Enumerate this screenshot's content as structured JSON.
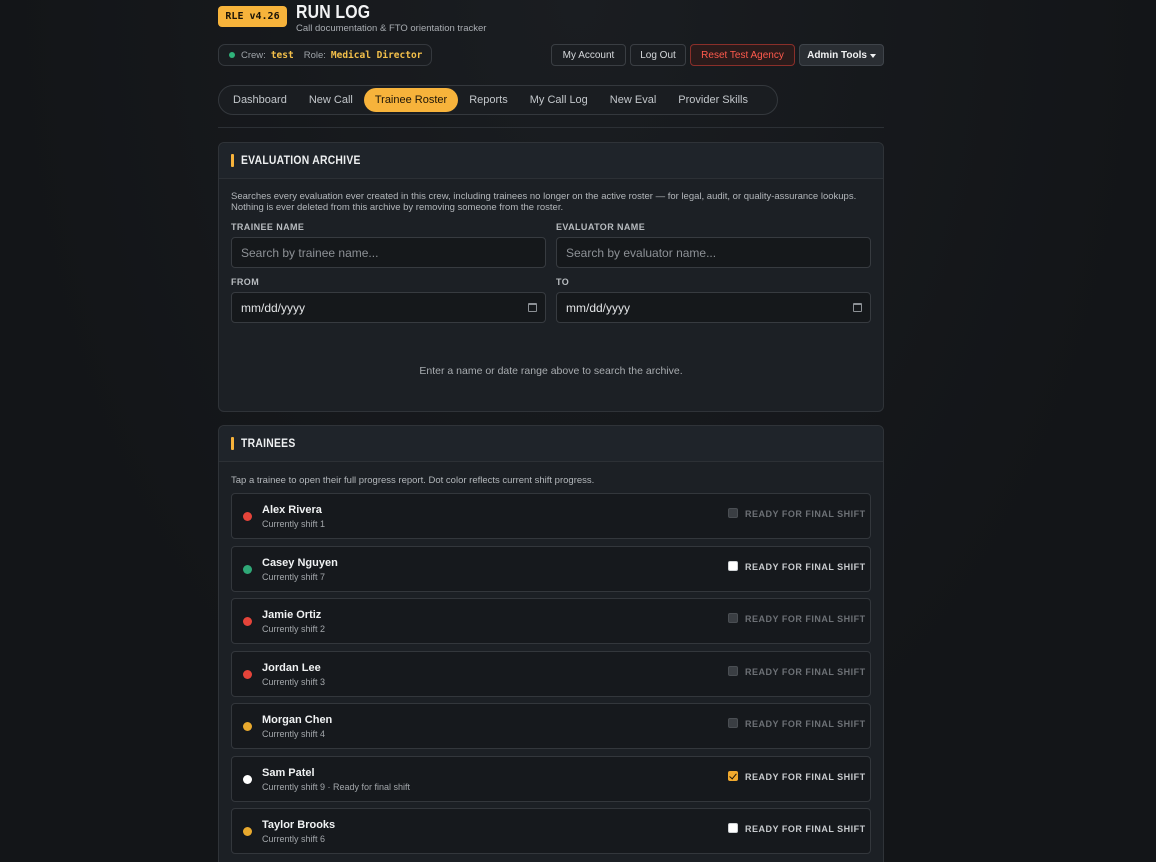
{
  "app": {
    "version": "RLE v4.26",
    "title": "RUN LOG",
    "subtitle": "Call documentation & FTO orientation tracker"
  },
  "session": {
    "crew_label": "Crew:",
    "crew_value": "test",
    "role_label": "Role:",
    "role_value": "Medical Director"
  },
  "toolbar": {
    "my_account": "My Account",
    "log_out": "Log Out",
    "reset": "Reset Test Agency",
    "admin": "Admin Tools"
  },
  "tabs": [
    {
      "label": "Dashboard",
      "active": false
    },
    {
      "label": "New Call",
      "active": false
    },
    {
      "label": "Trainee Roster",
      "active": true
    },
    {
      "label": "Reports",
      "active": false
    },
    {
      "label": "My Call Log",
      "active": false
    },
    {
      "label": "New Eval",
      "active": false
    },
    {
      "label": "Provider Skills",
      "active": false
    }
  ],
  "archive": {
    "title": "EVALUATION ARCHIVE",
    "description": "Searches every evaluation ever created in this crew, including trainees no longer on the active roster — for legal, audit, or quality-assurance lookups. Nothing is ever deleted from this archive by removing someone from the roster.",
    "trainee_label": "TRAINEE NAME",
    "trainee_placeholder": "Search by trainee name...",
    "evaluator_label": "EVALUATOR NAME",
    "evaluator_placeholder": "Search by evaluator name...",
    "from_label": "FROM",
    "from_value": "mm/dd/yyyy",
    "to_label": "TO",
    "to_value": "mm/dd/yyyy",
    "empty_message": "Enter a name or date range above to search the archive."
  },
  "trainees": {
    "title": "TRAINEES",
    "description": "Tap a trainee to open their full progress report. Dot color reflects current shift progress.",
    "ready_label": "READY FOR FINAL SHIFT",
    "list": [
      {
        "name": "Alex Rivera",
        "shift": "Currently shift 1",
        "dot_color": "#e5443a",
        "checkbox": "disabled"
      },
      {
        "name": "Casey Nguyen",
        "shift": "Currently shift 7",
        "dot_color": "#2fa877",
        "checkbox": "enabled"
      },
      {
        "name": "Jamie Ortiz",
        "shift": "Currently shift 2",
        "dot_color": "#e5443a",
        "checkbox": "disabled"
      },
      {
        "name": "Jordan Lee",
        "shift": "Currently shift 3",
        "dot_color": "#e5443a",
        "checkbox": "disabled"
      },
      {
        "name": "Morgan Chen",
        "shift": "Currently shift 4",
        "dot_color": "#e8a92e",
        "checkbox": "disabled"
      },
      {
        "name": "Sam Patel",
        "shift": "Currently shift 9 · Ready for final shift",
        "dot_color": "#ffffff",
        "checkbox": "checked"
      },
      {
        "name": "Taylor Brooks",
        "shift": "Currently shift 6",
        "dot_color": "#e8a92e",
        "checkbox": "enabled"
      }
    ]
  }
}
